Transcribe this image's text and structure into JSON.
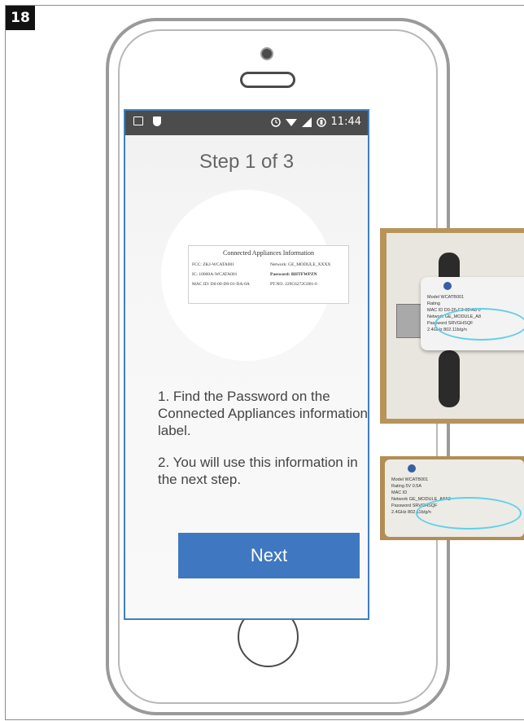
{
  "figure_number": "18",
  "status_bar": {
    "time": "11:44",
    "left_icons": [
      "picture-icon",
      "shield-icon"
    ],
    "right_icons": [
      "alarm-icon",
      "wifi-icon",
      "signal-icon",
      "battery-icon"
    ]
  },
  "screen": {
    "title": "Step 1 of 3",
    "label_card": {
      "title": "Connected Appliances Information",
      "fcc": "FCC: ZKJ-WCATA001",
      "network": "Network: GE_MODULE_XXXX",
      "ic": "IC: 10000A-WCATA001",
      "password": "Password: RHTFWPZN",
      "mac": "MAC ID: D0-00-D0-01-DA-0A",
      "ptno": "PT.NO. 229C6272G001-0"
    },
    "instruction_1": "1. Find the Password on the Connected Appliances information label.",
    "instruction_2": "2. You will use this information in the next step.",
    "next_label": "Next"
  },
  "photo_top": {
    "rows": [
      {
        "key": "Model",
        "value": "WCATB001"
      },
      {
        "key": "Rating",
        "value": ""
      },
      {
        "key": "MAC ID",
        "value": "D0-26-C3-02-A8 0"
      },
      {
        "key": "Network",
        "value": "GE_MODULE_A8"
      },
      {
        "key": "Password",
        "value": "SRVGHSQF"
      },
      {
        "key": "2.4GHz 802.11b/g/n",
        "value": ""
      }
    ]
  },
  "photo_bottom": {
    "rows": [
      {
        "key": "Model",
        "value": "WCATB001"
      },
      {
        "key": "Rating",
        "value": "5V 0.5A"
      },
      {
        "key": "MAC ID",
        "value": ""
      },
      {
        "key": "Network",
        "value": "GE_MODULE_A8A2"
      },
      {
        "key": "Password",
        "value": "SRVGHSQF"
      },
      {
        "key": "2.4GHz 802.11b/g/n",
        "value": ""
      }
    ]
  },
  "colors": {
    "accent": "#3f78c0",
    "highlight_ellipse": "#5fd0e8",
    "status_bar": "#4c4c4c"
  }
}
